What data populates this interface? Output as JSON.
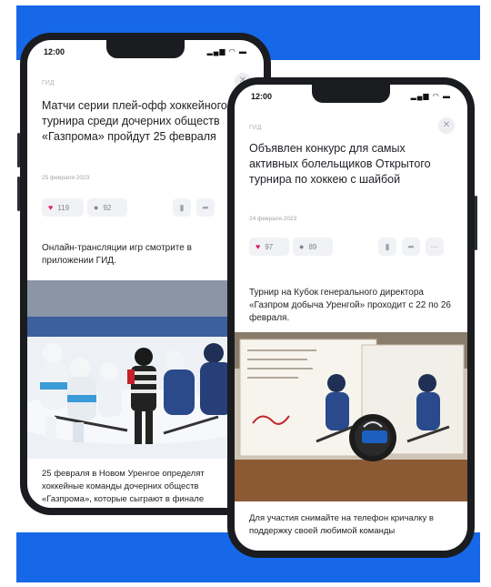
{
  "colors": {
    "brand_blue": "#1668e8",
    "like_red": "#e0245e"
  },
  "phone_left": {
    "time": "12:00",
    "status_icons": "signal-wifi-battery",
    "section": "ГИД",
    "title": "Матчи серии плей-офф хоккейного турнира среди дочерних обществ «Газпрома» пройдут 25 февраля",
    "date": "25 февраля 2023",
    "likes": "119",
    "comments": "92",
    "lead": "Онлайн-трансляции игр смотрите в приложении ГИД.",
    "body": "25 февраля в Новом Уренгое определят хоккейные команды дочерних обществ «Газпрома», которые сыграют в финале"
  },
  "phone_right": {
    "time": "12:00",
    "status_icons": "signal-wifi-battery",
    "section": "ГИД",
    "title": "Объявлен конкурс для самых активных болельщиков Открытого турнира по хоккею с шайбой",
    "date": "24 февраля 2023",
    "likes": "97",
    "comments": "89",
    "lead": "Турнир на Кубок генерального директора «Газпром добыча Уренгой» проходит с 22 по 26 февраля.",
    "body": "Для участия снимайте на телефон кричалку в поддержку своей любимой команды"
  }
}
